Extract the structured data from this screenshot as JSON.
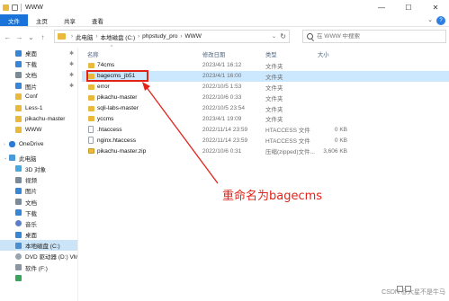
{
  "window": {
    "title": "WWW",
    "minimize": "—",
    "maximize": "☐",
    "close": "✕"
  },
  "ribbon": {
    "tabs": [
      "文件",
      "主页",
      "共享",
      "查看"
    ],
    "expand": "⌄",
    "help": "?"
  },
  "navigation": {
    "back": "←",
    "forward": "→",
    "recent": "⌄",
    "up": "↑",
    "breadcrumb": [
      "此电脑",
      "本地磁盘 (C:)",
      "phpstudy_pro",
      "WWW"
    ],
    "dropdown": "⌄",
    "refresh": "↻"
  },
  "search": {
    "placeholder": "在 WWW 中搜索"
  },
  "sidebar": {
    "items": [
      {
        "label": "桌面",
        "icon": "desktop-icon",
        "pinned": true
      },
      {
        "label": "下载",
        "icon": "download-icon",
        "pinned": true
      },
      {
        "label": "文档",
        "icon": "document-icon",
        "pinned": true
      },
      {
        "label": "图片",
        "icon": "picture-icon",
        "pinned": true
      },
      {
        "label": "Conf",
        "icon": "folder-icon",
        "pinned": false
      },
      {
        "label": "Less-1",
        "icon": "folder-icon",
        "pinned": false
      },
      {
        "label": "pikachu-master",
        "icon": "folder-icon",
        "pinned": false
      },
      {
        "label": "WWW",
        "icon": "folder-icon",
        "pinned": false
      },
      {
        "label": "OneDrive",
        "icon": "cloud-icon",
        "pinned": false
      },
      {
        "label": "此电脑",
        "icon": "pc-icon",
        "pinned": false
      },
      {
        "label": "3D 对象",
        "icon": "cube-icon",
        "pinned": false
      },
      {
        "label": "视频",
        "icon": "video-icon",
        "pinned": false
      },
      {
        "label": "图片",
        "icon": "picture-icon",
        "pinned": false
      },
      {
        "label": "文档",
        "icon": "document-icon",
        "pinned": false
      },
      {
        "label": "下载",
        "icon": "download-icon",
        "pinned": false
      },
      {
        "label": "音乐",
        "icon": "music-icon",
        "pinned": false
      },
      {
        "label": "桌面",
        "icon": "desktop-icon",
        "pinned": false
      },
      {
        "label": "本地磁盘 (C:)",
        "icon": "drive-icon",
        "pinned": false
      },
      {
        "label": "DVD 驱动器 (D:) VM",
        "icon": "dvd-icon",
        "pinned": false
      },
      {
        "label": "软件 (F:)",
        "icon": "drive-icon",
        "pinned": false
      },
      {
        "label": "",
        "icon": "network-icon",
        "pinned": false
      }
    ],
    "pin_glyph": "📌"
  },
  "filelist": {
    "columns": {
      "name": "名称",
      "date": "修改日期",
      "type": "类型",
      "size": "大小"
    },
    "sort_glyph": "^",
    "rows": [
      {
        "name": "74cms",
        "date": "2023/4/1 16:12",
        "type": "文件夹",
        "size": "",
        "kind": "folder"
      },
      {
        "name": "bagecms_jb51",
        "date": "2023/4/1 16:00",
        "type": "文件夹",
        "size": "",
        "kind": "folder"
      },
      {
        "name": "error",
        "date": "2022/10/5 1:53",
        "type": "文件夹",
        "size": "",
        "kind": "folder"
      },
      {
        "name": "pikachu-master",
        "date": "2022/10/6 0:33",
        "type": "文件夹",
        "size": "",
        "kind": "folder"
      },
      {
        "name": "sqli-labs-master",
        "date": "2022/10/5 23:54",
        "type": "文件夹",
        "size": "",
        "kind": "folder"
      },
      {
        "name": "yccms",
        "date": "2023/4/1 19:09",
        "type": "文件夹",
        "size": "",
        "kind": "folder"
      },
      {
        "name": ".htaccess",
        "date": "2022/11/14 23:59",
        "type": "HTACCESS 文件",
        "size": "0 KB",
        "kind": "file"
      },
      {
        "name": "nginx.htaccess",
        "date": "2022/11/14 23:59",
        "type": "HTACCESS 文件",
        "size": "0 KB",
        "kind": "file"
      },
      {
        "name": "pikachu-master.zip",
        "date": "2022/10/6 0:31",
        "type": "压缩(zipped)文件...",
        "size": "3,606 KB",
        "kind": "zip"
      }
    ]
  },
  "annotation": {
    "text": "重命名为bagecms",
    "color": "#e2231a"
  },
  "watermark": "CSDN @大星不是牛马",
  "colors": {
    "accent": "#1a73d9",
    "selection": "#cce8ff",
    "folder": "#e8b93c"
  }
}
